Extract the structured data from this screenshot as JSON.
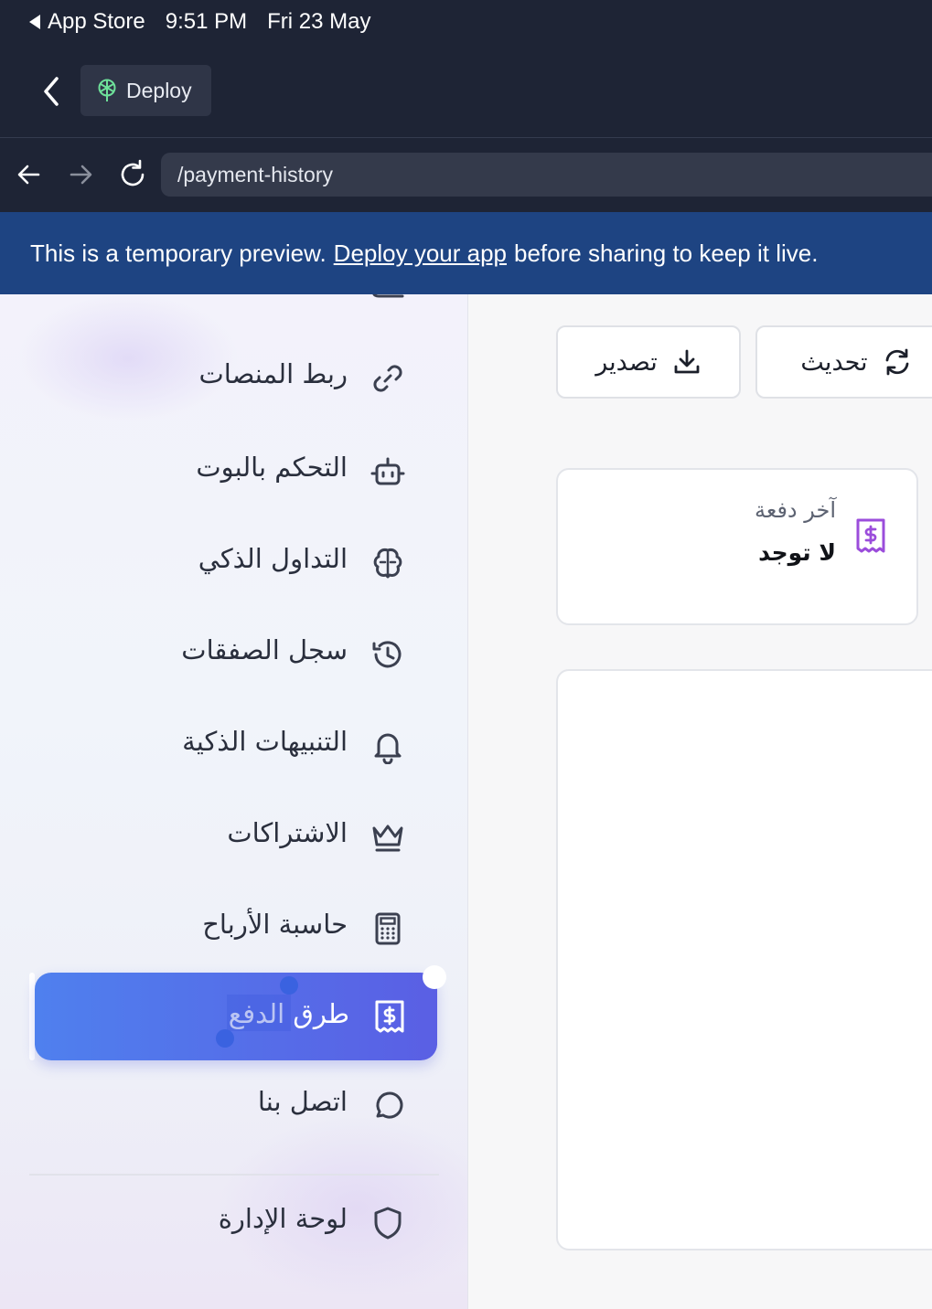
{
  "status_bar": {
    "back_app": "App Store",
    "time": "9:51 PM",
    "date": "Fri 23 May"
  },
  "header": {
    "deploy_label": "Deploy"
  },
  "browser": {
    "url": "/payment-history"
  },
  "banner": {
    "text_before": "This is a temporary preview.",
    "link": "Deploy your app",
    "text_after": "before sharing to keep it live."
  },
  "sidebar": {
    "items": [
      {
        "label": "ربط المنصات",
        "icon": "link-icon"
      },
      {
        "label": "التحكم بالبوت",
        "icon": "bot-icon"
      },
      {
        "label": "التداول الذكي",
        "icon": "brain-icon"
      },
      {
        "label": "سجل الصفقات",
        "icon": "history-icon"
      },
      {
        "label": "التنبيهات الذكية",
        "icon": "bell-icon"
      },
      {
        "label": "الاشتراكات",
        "icon": "crown-icon"
      },
      {
        "label": "حاسبة الأرباح",
        "icon": "calculator-icon"
      },
      {
        "label": "طرق الدفع",
        "icon": "receipt-icon",
        "active": true
      },
      {
        "label": "اتصل بنا",
        "icon": "message-circle-icon"
      }
    ],
    "admin": {
      "label": "لوحة الإدارة",
      "icon": "shield-icon"
    }
  },
  "main": {
    "export_label": "تصدير",
    "refresh_label": "تحديث",
    "last_payment": {
      "title": "آخر دفعة",
      "value": "لا توجد"
    }
  },
  "colors": {
    "active_start": "#4f80ee",
    "active_end": "#5a5fe4",
    "banner": "#1e4482",
    "accent_purple": "#9b4ddb"
  }
}
